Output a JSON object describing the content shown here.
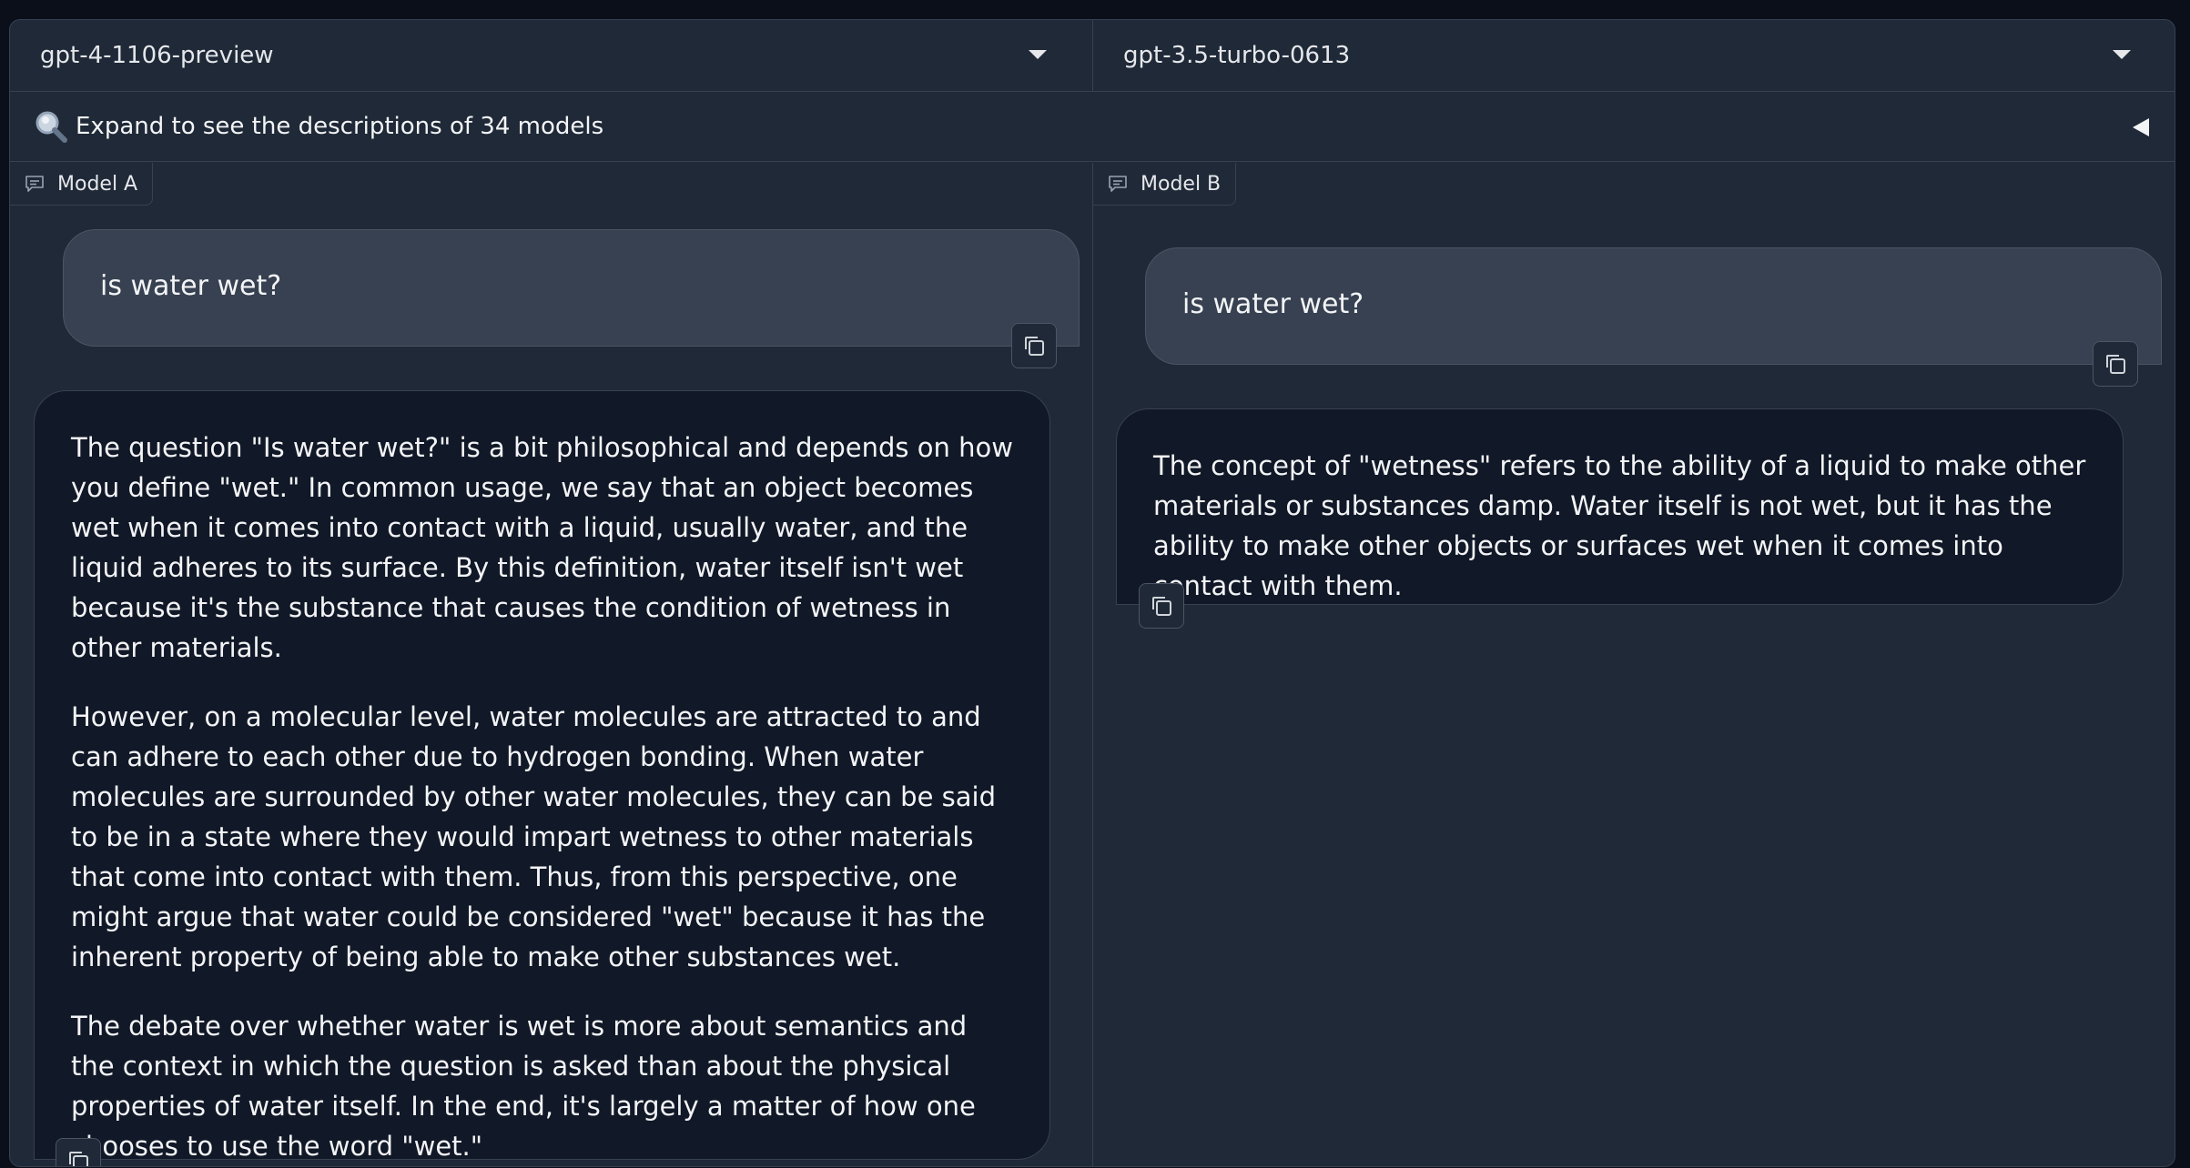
{
  "selectors": {
    "left_model": "gpt-4-1106-preview",
    "right_model": "gpt-3.5-turbo-0613"
  },
  "expand": {
    "text": "Expand to see the descriptions of 34 models",
    "icon": "magnifier-icon"
  },
  "panels": {
    "left": {
      "label": "Model A",
      "user_message": "is water wet?",
      "bot_paragraphs": [
        "The question \"Is water wet?\" is a bit philosophical and depends on how you define \"wet.\" In common usage, we say that an object becomes wet when it comes into contact with a liquid, usually water, and the liquid adheres to its surface. By this definition, water itself isn't wet because it's the substance that causes the condition of wetness in other materials.",
        "However, on a molecular level, water molecules are attracted to and can adhere to each other due to hydrogen bonding. When water molecules are surrounded by other water molecules, they can be said to be in a state where they would impart wetness to other materials that come into contact with them. Thus, from this perspective, one might argue that water could be considered \"wet\" because it has the inherent property of being able to make other substances wet.",
        "The debate over whether water is wet is more about semantics and the context in which the question is asked than about the physical properties of water itself. In the end, it's largely a matter of how one chooses to use the word \"wet.\""
      ]
    },
    "right": {
      "label": "Model B",
      "user_message": "is water wet?",
      "bot_paragraphs": [
        "The concept of \"wetness\" refers to the ability of a liquid to make other materials or substances damp. Water itself is not wet, but it has the ability to make other objects or surfaces wet when it comes into contact with them."
      ]
    }
  },
  "icons": {
    "chat": "chat-bubble-icon",
    "copy": "copy-icon",
    "dropdown": "chevron-down-icon",
    "collapse": "triangle-left-icon"
  }
}
